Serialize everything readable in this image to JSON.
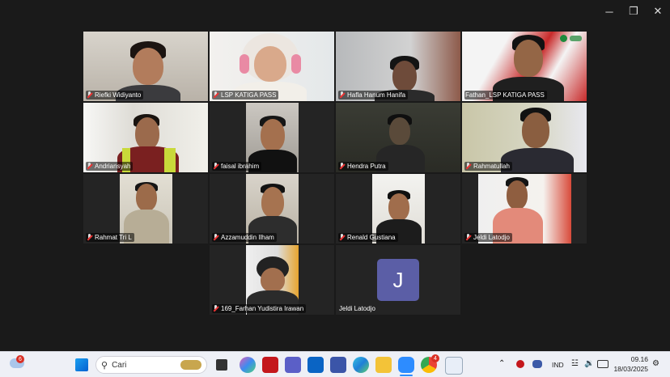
{
  "window": {
    "minimize": "─",
    "restore": "❐",
    "close": "✕"
  },
  "participants": [
    {
      "name": "Riefki Widiyanto"
    },
    {
      "name": "LSP KATIGA PASS"
    },
    {
      "name": "Hafla Hanum Hanifa"
    },
    {
      "name": "Fathan_LSP KATIGA PASS"
    },
    {
      "name": "Andriansyah"
    },
    {
      "name": "faisal ibrahim"
    },
    {
      "name": "Hendra Putra"
    },
    {
      "name": "Rahmatullah"
    },
    {
      "name": "Rahmat Tri L"
    },
    {
      "name": "Azzamuddin Ilham"
    },
    {
      "name": "Renald Gustiana"
    },
    {
      "name": "Jeldi Latodjo"
    },
    {
      "name": "169_Farhan Yudistira Irawan"
    },
    {
      "name": "Jeldi Latodjo",
      "avatar_letter": "J"
    }
  ],
  "taskbar": {
    "weather_badge": "6",
    "search_placeholder": "Cari",
    "chrome_badge": "4",
    "language": "IND",
    "time": "09.16",
    "date": "18/03/2025"
  }
}
